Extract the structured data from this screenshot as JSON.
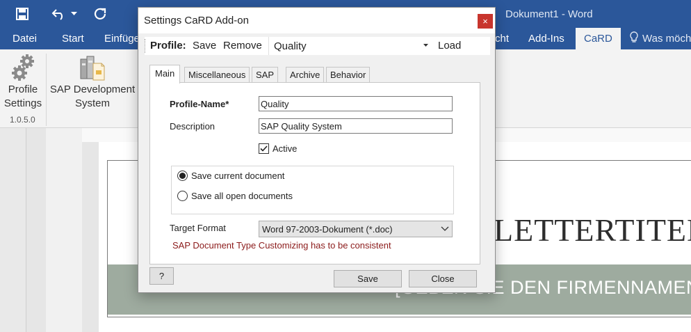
{
  "word": {
    "title": "Dokument1 - Word",
    "tabs": [
      "Datei",
      "Start",
      "Einfüge",
      "cht",
      "Add-Ins",
      "CaRD"
    ],
    "tell_me": "Was möch",
    "ribbon": {
      "profile_settings_line1": "Profile",
      "profile_settings_line2": "Settings",
      "version": "1.0.5.0",
      "sap_system_line1": "SAP Development",
      "sap_system_line2": "System"
    }
  },
  "document": {
    "letter_title": "LETTERTITEL",
    "company_placeholder": "[GEBEN SIE DEN FIRMENNAMEN E"
  },
  "dialog": {
    "title": "Settings CaRD Add-on",
    "close_glyph": "×",
    "profile_bar": {
      "label": "Profile:",
      "save": "Save",
      "remove": "Remove",
      "selected": "Quality",
      "load": "Load"
    },
    "tabs": [
      "Main",
      "Miscellaneous",
      "SAP",
      "Archive",
      "Behavior"
    ],
    "main": {
      "profile_name_label": "Profile-Name*",
      "profile_name_value": "Quality",
      "description_label": "Description",
      "description_value": "SAP Quality System",
      "active_label": "Active",
      "active_checked": true,
      "save_options": [
        "Save current document",
        "Save all open documents"
      ],
      "selected_save_option": 0,
      "target_format_label": "Target Format",
      "target_format_value": "Word 97-2003-Dokument (*.doc)",
      "warning": "SAP Document Type Customizing has to be consistent"
    },
    "buttons": {
      "help": "?",
      "save": "Save",
      "close": "Close"
    }
  },
  "colors": {
    "word_blue": "#2b579a",
    "close_red": "#c8352d",
    "warning_red": "#8b1a1a",
    "banner_green": "#9eab9f"
  }
}
